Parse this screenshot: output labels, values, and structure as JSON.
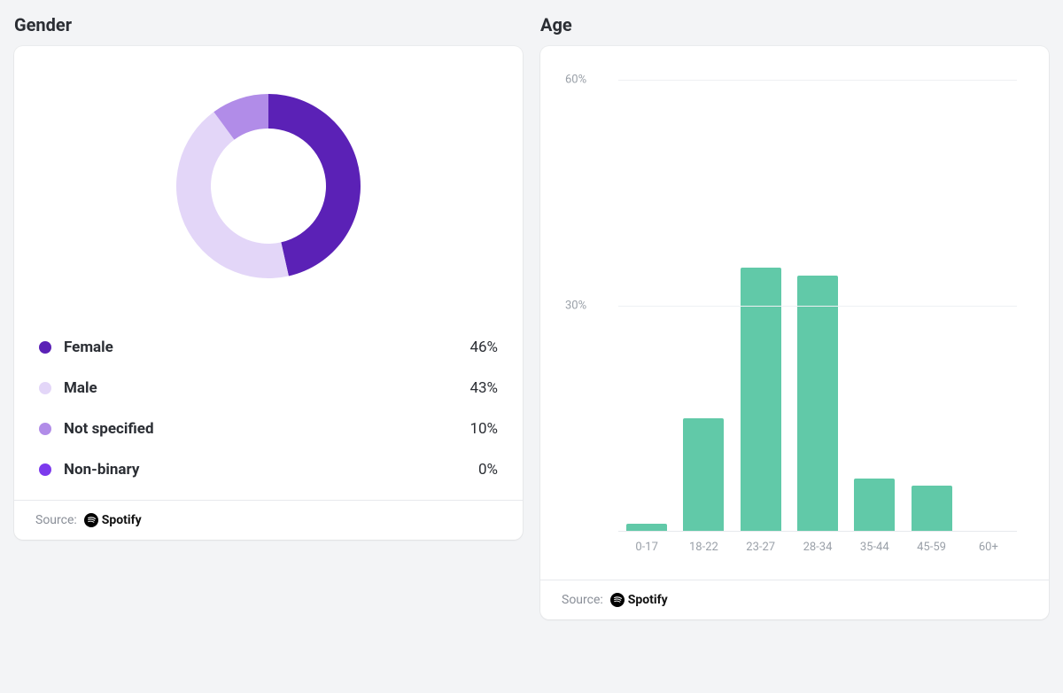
{
  "gender": {
    "title": "Gender",
    "source_label": "Source:",
    "source_name": "Spotify",
    "items": [
      {
        "label": "Female",
        "value": 46,
        "value_text": "46%",
        "color": "#5b21b6"
      },
      {
        "label": "Male",
        "value": 43,
        "value_text": "43%",
        "color": "#e3d6f8"
      },
      {
        "label": "Not specified",
        "value": 10,
        "value_text": "10%",
        "color": "#b18ce8"
      },
      {
        "label": "Non-binary",
        "value": 0,
        "value_text": "0%",
        "color": "#7c3aed"
      }
    ]
  },
  "age": {
    "title": "Age",
    "source_label": "Source:",
    "source_name": "Spotify",
    "yticks": [
      {
        "value": 60,
        "label": "60%"
      },
      {
        "value": 30,
        "label": "30%"
      }
    ],
    "ymax": 60,
    "bars": [
      {
        "label": "0-17",
        "value": 1
      },
      {
        "label": "18-22",
        "value": 15
      },
      {
        "label": "23-27",
        "value": 35
      },
      {
        "label": "28-34",
        "value": 34
      },
      {
        "label": "35-44",
        "value": 7
      },
      {
        "label": "45-59",
        "value": 6
      },
      {
        "label": "60+",
        "value": 0
      }
    ]
  },
  "chart_data": [
    {
      "type": "pie",
      "title": "Gender",
      "series": [
        {
          "name": "Female",
          "value": 46,
          "color": "#5b21b6"
        },
        {
          "name": "Male",
          "value": 43,
          "color": "#e3d6f8"
        },
        {
          "name": "Not specified",
          "value": 10,
          "color": "#b18ce8"
        },
        {
          "name": "Non-binary",
          "value": 0,
          "color": "#7c3aed"
        }
      ],
      "hole": 0.62
    },
    {
      "type": "bar",
      "title": "Age",
      "categories": [
        "0-17",
        "18-22",
        "23-27",
        "28-34",
        "35-44",
        "45-59",
        "60+"
      ],
      "values": [
        1,
        15,
        35,
        34,
        7,
        6,
        0
      ],
      "ylabel": "",
      "xlabel": "",
      "ylim": [
        0,
        60
      ],
      "bar_color": "#61c9a8"
    }
  ]
}
